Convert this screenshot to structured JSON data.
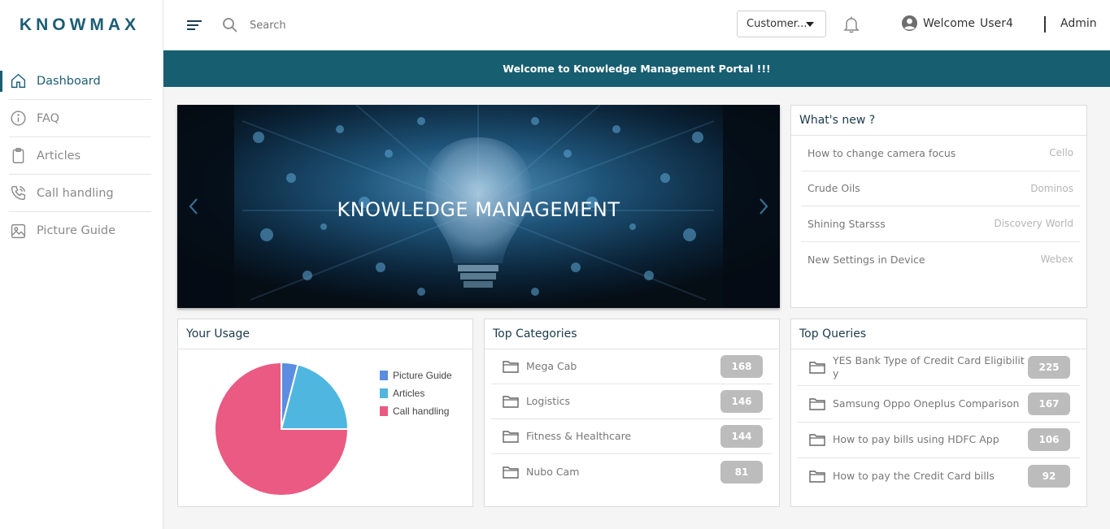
{
  "brand": {
    "logo": "KNOWMAX",
    "accent": "#1c5d74",
    "banner_color": "#175e71"
  },
  "sidebar": {
    "items": [
      {
        "label": "Dashboard",
        "icon": "home-icon",
        "active": true
      },
      {
        "label": "FAQ",
        "icon": "info-icon",
        "active": false
      },
      {
        "label": "Articles",
        "icon": "clipboard-icon",
        "active": false
      },
      {
        "label": "Call handling",
        "icon": "phone-icon",
        "active": false
      },
      {
        "label": "Picture Guide",
        "icon": "image-icon",
        "active": false
      }
    ]
  },
  "header": {
    "search_placeholder": "Search",
    "dropdown_value": "Customer...",
    "welcome": "Welcome",
    "user": "User4",
    "role": "Admin"
  },
  "banner": {
    "text": "Welcome to Knowledge Management Portal !!!"
  },
  "carousel": {
    "title": "KNOWLEDGE MANAGEMENT"
  },
  "whats_new": {
    "title": "What's new ?",
    "items": [
      {
        "title": "How to change camera focus",
        "source": "Cello"
      },
      {
        "title": "Crude Oils",
        "source": "Dominos"
      },
      {
        "title": "Shining Starsss",
        "source": "Discovery World"
      },
      {
        "title": "New Settings in Device",
        "source": "Webex"
      }
    ]
  },
  "usage": {
    "title": "Your Usage"
  },
  "chart_data": {
    "type": "pie",
    "categories": [
      "Picture Guide",
      "Articles",
      "Call handling"
    ],
    "values": [
      4,
      21,
      75
    ],
    "colors": [
      "#5b8de0",
      "#4fb6df",
      "#ea5a82"
    ],
    "legend": "right"
  },
  "top_categories": {
    "title": "Top Categories",
    "items": [
      {
        "label": "Mega Cab",
        "count": "168"
      },
      {
        "label": "Logistics",
        "count": "146"
      },
      {
        "label": "Fitness & Healthcare",
        "count": "144"
      },
      {
        "label": "Nubo Cam",
        "count": "81"
      }
    ]
  },
  "top_queries": {
    "title": "Top Queries",
    "items": [
      {
        "label": "YES Bank Type of Credit Card Eligibility",
        "count": "225"
      },
      {
        "label": "Samsung Oppo Oneplus Comparison",
        "count": "167"
      },
      {
        "label": "How to pay bills using HDFC App",
        "count": "106"
      },
      {
        "label": "How to pay the Credit Card bills",
        "count": "92"
      }
    ]
  }
}
